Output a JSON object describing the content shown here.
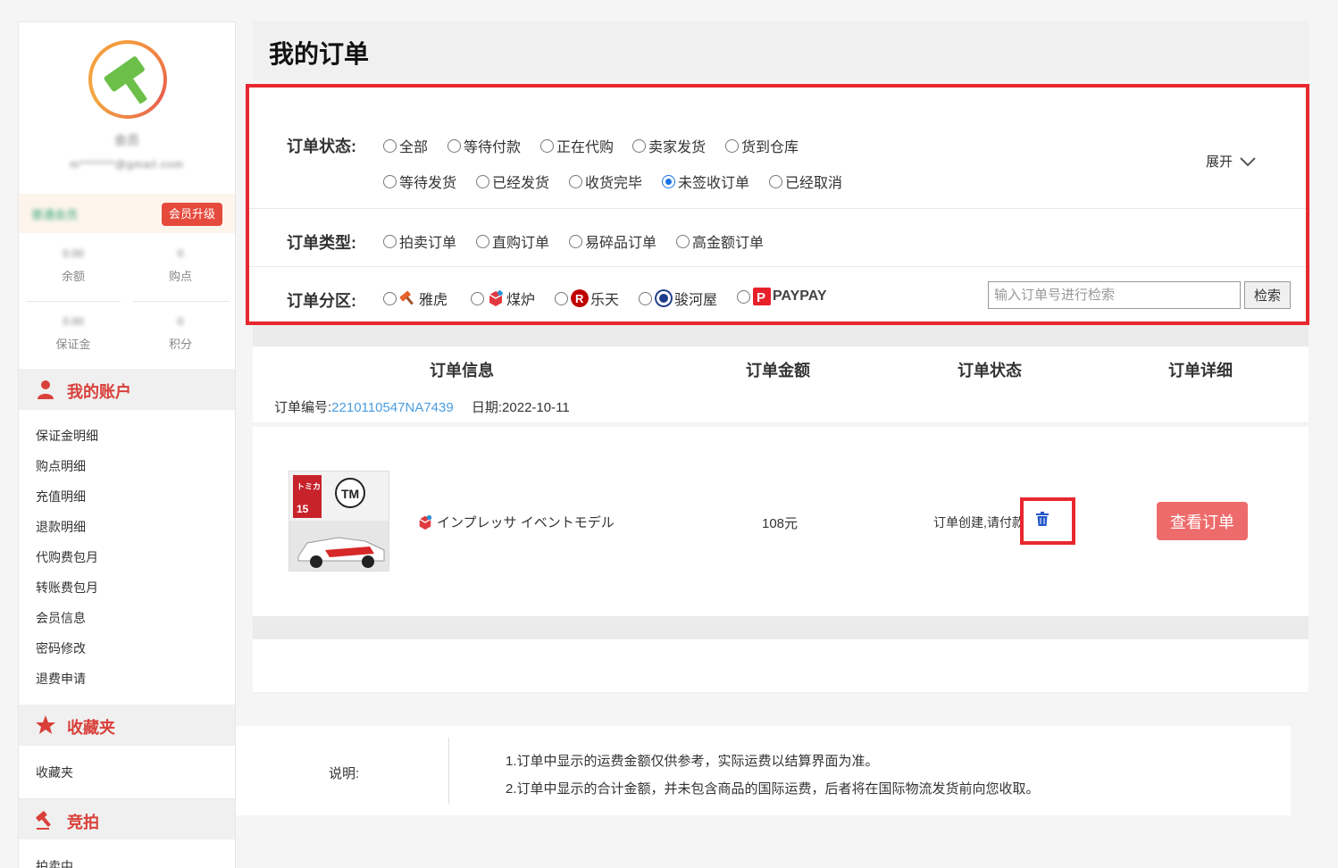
{
  "sidebar": {
    "username": "会员",
    "email": "m*******@gmail.com",
    "member_level": "普通会员",
    "upgrade_label": "会员升级",
    "stats": [
      {
        "value": "0.00",
        "label": "余额"
      },
      {
        "value": "0",
        "label": "购点"
      },
      {
        "value": "0.00",
        "label": "保证金"
      },
      {
        "value": "0",
        "label": "积分"
      }
    ],
    "account_title": "我的账户",
    "account_items": [
      "保证金明细",
      "购点明细",
      "充值明细",
      "退款明细",
      "代购费包月",
      "转账费包月",
      "会员信息",
      "密码修改",
      "退费申请"
    ],
    "favorites_title": "收藏夹",
    "favorites_items": [
      "收藏夹"
    ],
    "auction_title": "竞拍",
    "auction_items": [
      "拍卖中"
    ]
  },
  "page": {
    "title": "我的订单"
  },
  "filters": {
    "status_label": "订单状态:",
    "status_options": [
      "全部",
      "等待付款",
      "正在代购",
      "卖家发货",
      "货到仓库",
      "等待发货",
      "已经发货",
      "收货完毕",
      "未签收订单",
      "已经取消"
    ],
    "status_selected": "未签收订单",
    "expand_label": "展开",
    "type_label": "订单类型:",
    "type_options": [
      "拍卖订单",
      "直购订单",
      "易碎品订单",
      "高金额订单"
    ],
    "zone_label": "订单分区:",
    "zone_options": [
      "雅虎",
      "煤炉",
      "乐天",
      "骏河屋",
      "PAYPAY"
    ],
    "search_placeholder": "输入订单号进行检索",
    "search_button": "检索"
  },
  "table": {
    "headers": [
      "订单信息",
      "订单金额",
      "订单状态",
      "订单详细"
    ],
    "order_no_label": "订单编号:",
    "order_no": "2210110547NA7439",
    "date_label": "日期:",
    "date": "2022-10-11",
    "item_name": "インプレッサ イベントモデル",
    "amount": "108元",
    "status": "订单创建,请付款",
    "view_button": "查看订单"
  },
  "notes": {
    "label": "说明:",
    "lines": [
      "1.订单中显示的运费金额仅供参考，实际运费以结算界面为准。",
      "2.订单中显示的合计金额，并未包含商品的国际运费，后者将在国际物流发货前向您收取。"
    ]
  },
  "colors": {
    "accent_red": "#d9403a",
    "highlight_border": "#e8282e",
    "link_blue": "#4a9de0",
    "button_pink": "#ee6b6b"
  }
}
